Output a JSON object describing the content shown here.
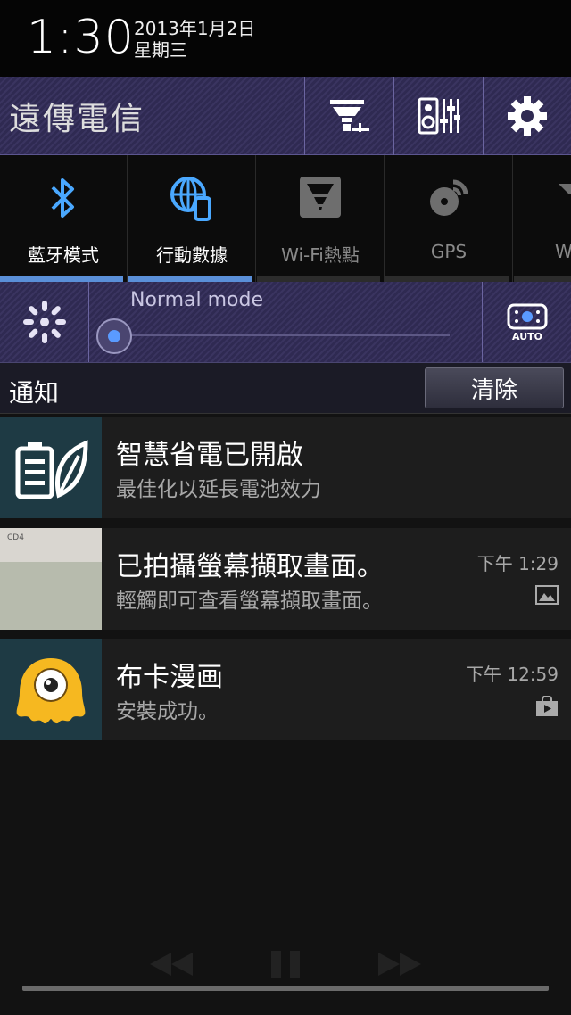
{
  "status": {
    "time": "1:30",
    "date": "2013年1月2日",
    "weekday": "星期三"
  },
  "operator": {
    "name": "遠傳電信"
  },
  "toggles": [
    {
      "label": "藍牙模式",
      "icon": "bluetooth-icon",
      "state": "on"
    },
    {
      "label": "行動數據",
      "icon": "mobile-data-globe-icon",
      "state": "on"
    },
    {
      "label": "Wi-Fi熱點",
      "icon": "wifi-hotspot-icon",
      "state": "off"
    },
    {
      "label": "GPS",
      "icon": "gps-satellite-icon",
      "state": "off"
    },
    {
      "label": "W",
      "icon": "wifi-icon",
      "state": "off"
    }
  ],
  "brightness": {
    "mode": "Normal mode",
    "auto_label": "AUTO",
    "level": 0.0
  },
  "notifications_header": {
    "title": "通知",
    "clear_label": "清除"
  },
  "notifications": [
    {
      "title": "智慧省電已開啟",
      "subtitle": "最佳化以延長電池效力",
      "time": "",
      "icon": "battery-leaf-icon"
    },
    {
      "title": "已拍攝螢幕擷取畫面。",
      "subtitle": "輕觸即可查看螢幕擷取畫面。",
      "time": "下午 1:29",
      "icon": "screenshot-thumbnail",
      "thumb_text": "CD4",
      "status_icon": "image-icon"
    },
    {
      "title": "布卡漫画",
      "subtitle": "安裝成功。",
      "time": "下午 12:59",
      "icon": "buka-mascot-icon",
      "status_icon": "play-store-bag-icon"
    }
  ],
  "colors": {
    "accent": "#5a8fd8",
    "panel": "#2f2a52",
    "notif_bg": "#1d1d1d"
  }
}
